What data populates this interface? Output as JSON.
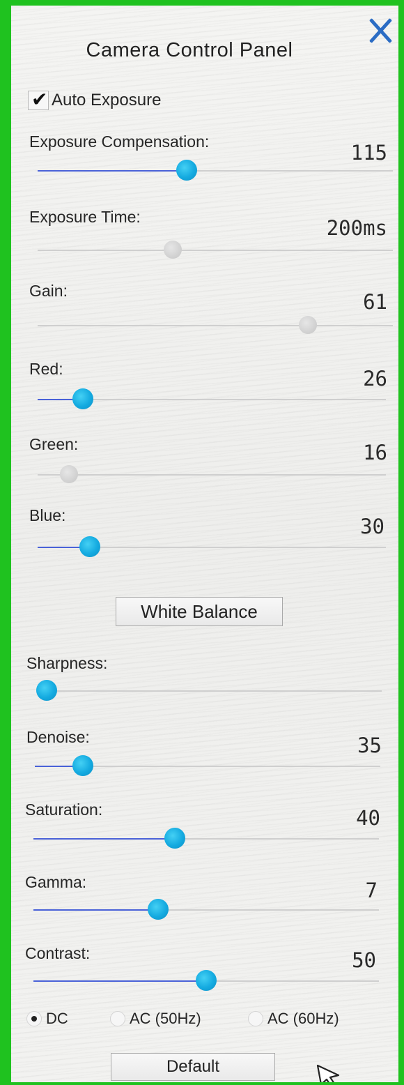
{
  "window": {
    "title": "Camera Control Panel",
    "close_icon": "close-x-icon"
  },
  "auto_exposure": {
    "label": "Auto Exposure",
    "checked": true
  },
  "sliders": [
    {
      "id": "exposure-compensation",
      "label": "Exposure Compensation:",
      "value_text": "115",
      "level": 0.42,
      "enabled": true
    },
    {
      "id": "exposure-time",
      "label": "Exposure Time:",
      "value_text": "200ms",
      "level": 0.38,
      "enabled": false
    },
    {
      "id": "gain",
      "label": "Gain:",
      "value_text": "61",
      "level": 0.76,
      "enabled": false
    },
    {
      "id": "red",
      "label": "Red:",
      "value_text": "26",
      "level": 0.13,
      "enabled": true
    },
    {
      "id": "green",
      "label": "Green:",
      "value_text": "16",
      "level": 0.09,
      "enabled": false
    },
    {
      "id": "blue",
      "label": "Blue:",
      "value_text": "30",
      "level": 0.15,
      "enabled": true
    },
    {
      "id": "sharpness",
      "label": "Sharpness:",
      "value_text": "",
      "level": 0.0,
      "enabled": true
    },
    {
      "id": "denoise",
      "label": "Denoise:",
      "value_text": "35",
      "level": 0.14,
      "enabled": true
    },
    {
      "id": "saturation",
      "label": "Saturation:",
      "value_text": "40",
      "level": 0.41,
      "enabled": true
    },
    {
      "id": "gamma",
      "label": "Gamma:",
      "value_text": "7",
      "level": 0.36,
      "enabled": true
    },
    {
      "id": "contrast",
      "label": "Contrast:",
      "value_text": "50",
      "level": 0.5,
      "enabled": true
    }
  ],
  "white_balance_button": "White Balance",
  "power_frequency": {
    "options": [
      "DC",
      "AC (50Hz)",
      "AC (60Hz)"
    ],
    "selected": "DC"
  },
  "default_button": "Default",
  "colors": {
    "frame_border": "#1fc21f",
    "close_icon": "#2b6cc4",
    "slider_fill": "#4a62d8",
    "slider_thumb": "#14aae0",
    "slider_thumb_disabled": "#d2d2d2"
  }
}
